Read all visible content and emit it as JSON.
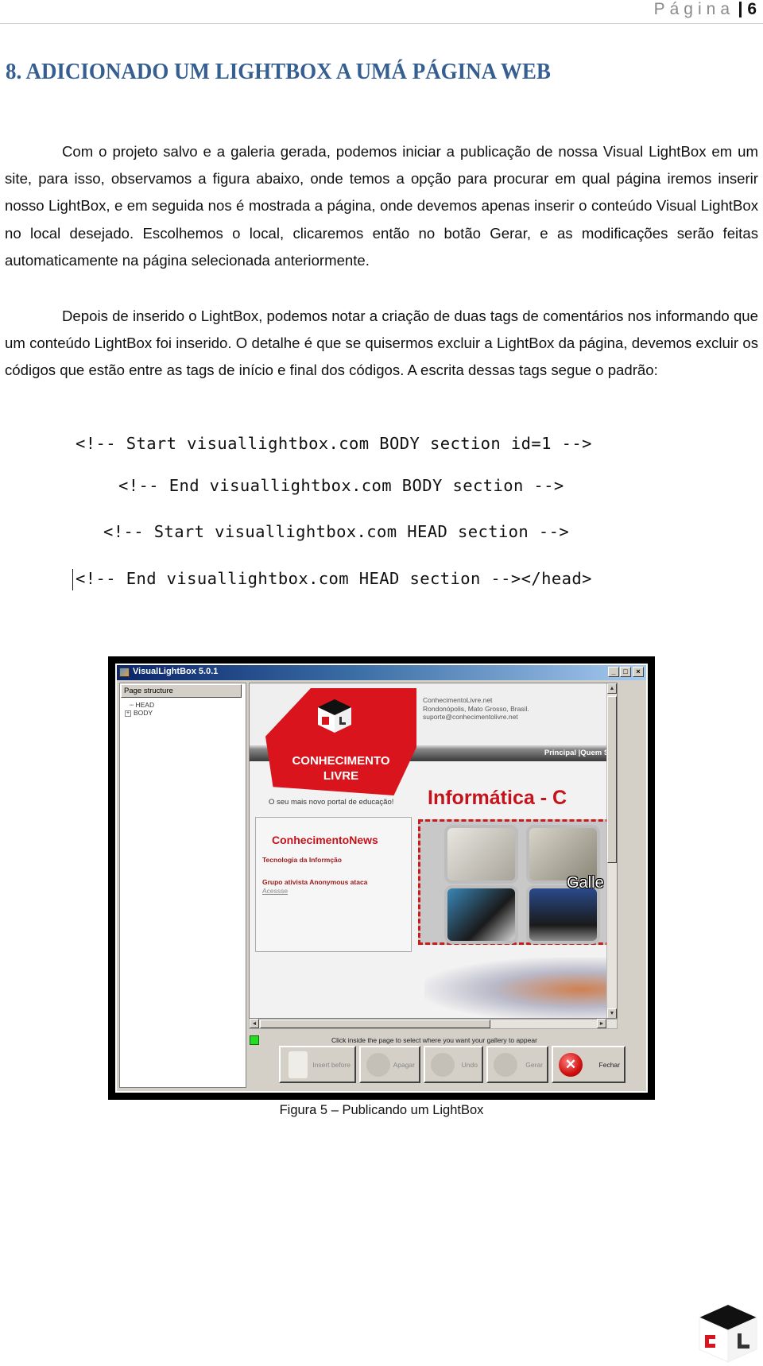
{
  "header": {
    "page_label": "Página",
    "page_number": "6"
  },
  "heading": "8.  ADICIONADO UM LIGHTBOX A UMÁ PÁGINA WEB",
  "paragraphs": [
    "Com o projeto salvo e a galeria gerada, podemos iniciar a publicação de nossa Visual LightBox em um site, para isso, observamos a figura abaixo, onde temos a opção para procurar em qual página iremos inserir nosso LightBox, e em seguida nos é mostrada a página, onde devemos apenas inserir o conteúdo Visual LightBox no local desejado. Escolhemos o local, clicaremos então no botão Gerar, e as modificações serão feitas automaticamente na página selecionada anteriormente.",
    "Depois de inserido o LightBox, podemos notar a criação de duas tags de comentários nos informando que um conteúdo LightBox foi inserido. O detalhe é que se quisermos excluir a LightBox da página, devemos excluir os códigos que estão entre as tags de início e final dos códigos. A escrita dessas tags segue o padrão:"
  ],
  "code_lines": [
    "<!-- Start visuallightbox.com BODY section id=1 -->",
    "<!-- End visuallightbox.com BODY section -->",
    "<!-- Start visuallightbox.com HEAD section -->",
    "<!-- End visuallightbox.com HEAD section --></head>"
  ],
  "figure": {
    "window_title": "VisualLightBox 5.0.1",
    "window_controls": {
      "minimize": "_",
      "maximize": "□",
      "close": "×"
    },
    "left_panel": {
      "header": "Page structure",
      "tree": [
        {
          "label": "HEAD",
          "expandable": false
        },
        {
          "label": "BODY",
          "expandable": true,
          "toggle": "+"
        }
      ]
    },
    "site": {
      "contact_lines": [
        "ConhecimentoLivre.net",
        "Rondonópolis, Mato Grosso, Brasil.",
        "suporte@conhecimentolivre.net"
      ],
      "nav": "Principal |Quem So",
      "logo_title": "CONHECIMENTO LIVRE",
      "tagline": "O seu mais novo portal de educação!",
      "section_title": "Informática - C",
      "news": {
        "title": "ConhecimentoNews",
        "items": [
          "Tecnologia da Informção",
          "Grupo ativista Anonymous ataca"
        ],
        "link": "Acessse"
      },
      "gallery_label": "Galle"
    },
    "scroll": {
      "up": "▲",
      "down": "▼",
      "left": "◄",
      "right": "►"
    },
    "status_message": "Click inside the page to select where you want your gallery to appear",
    "status_color": "#22dd22",
    "buttons": [
      {
        "label": "Insert before",
        "enabled": false
      },
      {
        "label": "Apagar",
        "enabled": false
      },
      {
        "label": "Undo",
        "enabled": false
      },
      {
        "label": "Gerar",
        "enabled": false
      },
      {
        "label": "Fechar",
        "enabled": true,
        "icon": "✕"
      }
    ]
  },
  "caption": "Figura 5 – Publicando um LightBox",
  "colors": {
    "heading": "#365f91",
    "brand_red": "#c4131a"
  }
}
